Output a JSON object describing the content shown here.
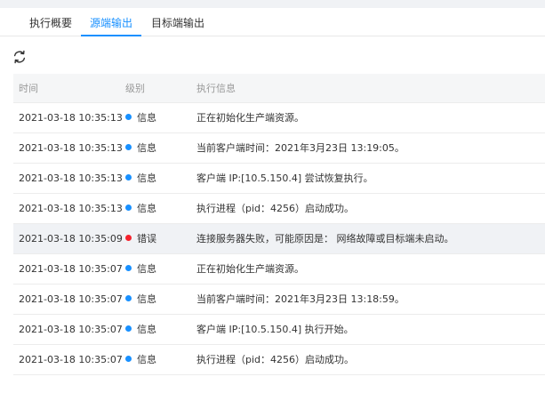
{
  "tabs": [
    {
      "label": "执行概要",
      "active": false
    },
    {
      "label": "源端输出",
      "active": true
    },
    {
      "label": "目标端输出",
      "active": false
    }
  ],
  "toolbar": {
    "refresh_icon": "refresh-icon"
  },
  "colors": {
    "accent": "#1890ff",
    "info": "#1890ff",
    "error": "#f5222d",
    "header_bg": "#f5f6f7",
    "highlight_bg": "#f0f2f5"
  },
  "table": {
    "columns": [
      "时间",
      "级别",
      "执行信息"
    ],
    "rows": [
      {
        "time": "2021-03-18 10:35:13",
        "level": "信息",
        "level_type": "info",
        "message": "正在初始化生产端资源。"
      },
      {
        "time": "2021-03-18 10:35:13",
        "level": "信息",
        "level_type": "info",
        "message": "当前客户端时间：2021年3月23日 13:19:05。"
      },
      {
        "time": "2021-03-18 10:35:13",
        "level": "信息",
        "level_type": "info",
        "message": "客户端 IP:[10.5.150.4] 尝试恢复执行。"
      },
      {
        "time": "2021-03-18 10:35:13",
        "level": "信息",
        "level_type": "info",
        "message": "执行进程（pid：4256）启动成功。"
      },
      {
        "time": "2021-03-18 10:35:09",
        "level": "错误",
        "level_type": "error",
        "message": "连接服务器失败，可能原因是： 网络故障或目标端未启动。",
        "highlighted": true
      },
      {
        "time": "2021-03-18 10:35:07",
        "level": "信息",
        "level_type": "info",
        "message": "正在初始化生产端资源。"
      },
      {
        "time": "2021-03-18 10:35:07",
        "level": "信息",
        "level_type": "info",
        "message": "当前客户端时间：2021年3月23日 13:18:59。"
      },
      {
        "time": "2021-03-18 10:35:07",
        "level": "信息",
        "level_type": "info",
        "message": "客户端 IP:[10.5.150.4] 执行开始。"
      },
      {
        "time": "2021-03-18 10:35:07",
        "level": "信息",
        "level_type": "info",
        "message": "执行进程（pid：4256）启动成功。"
      }
    ]
  }
}
